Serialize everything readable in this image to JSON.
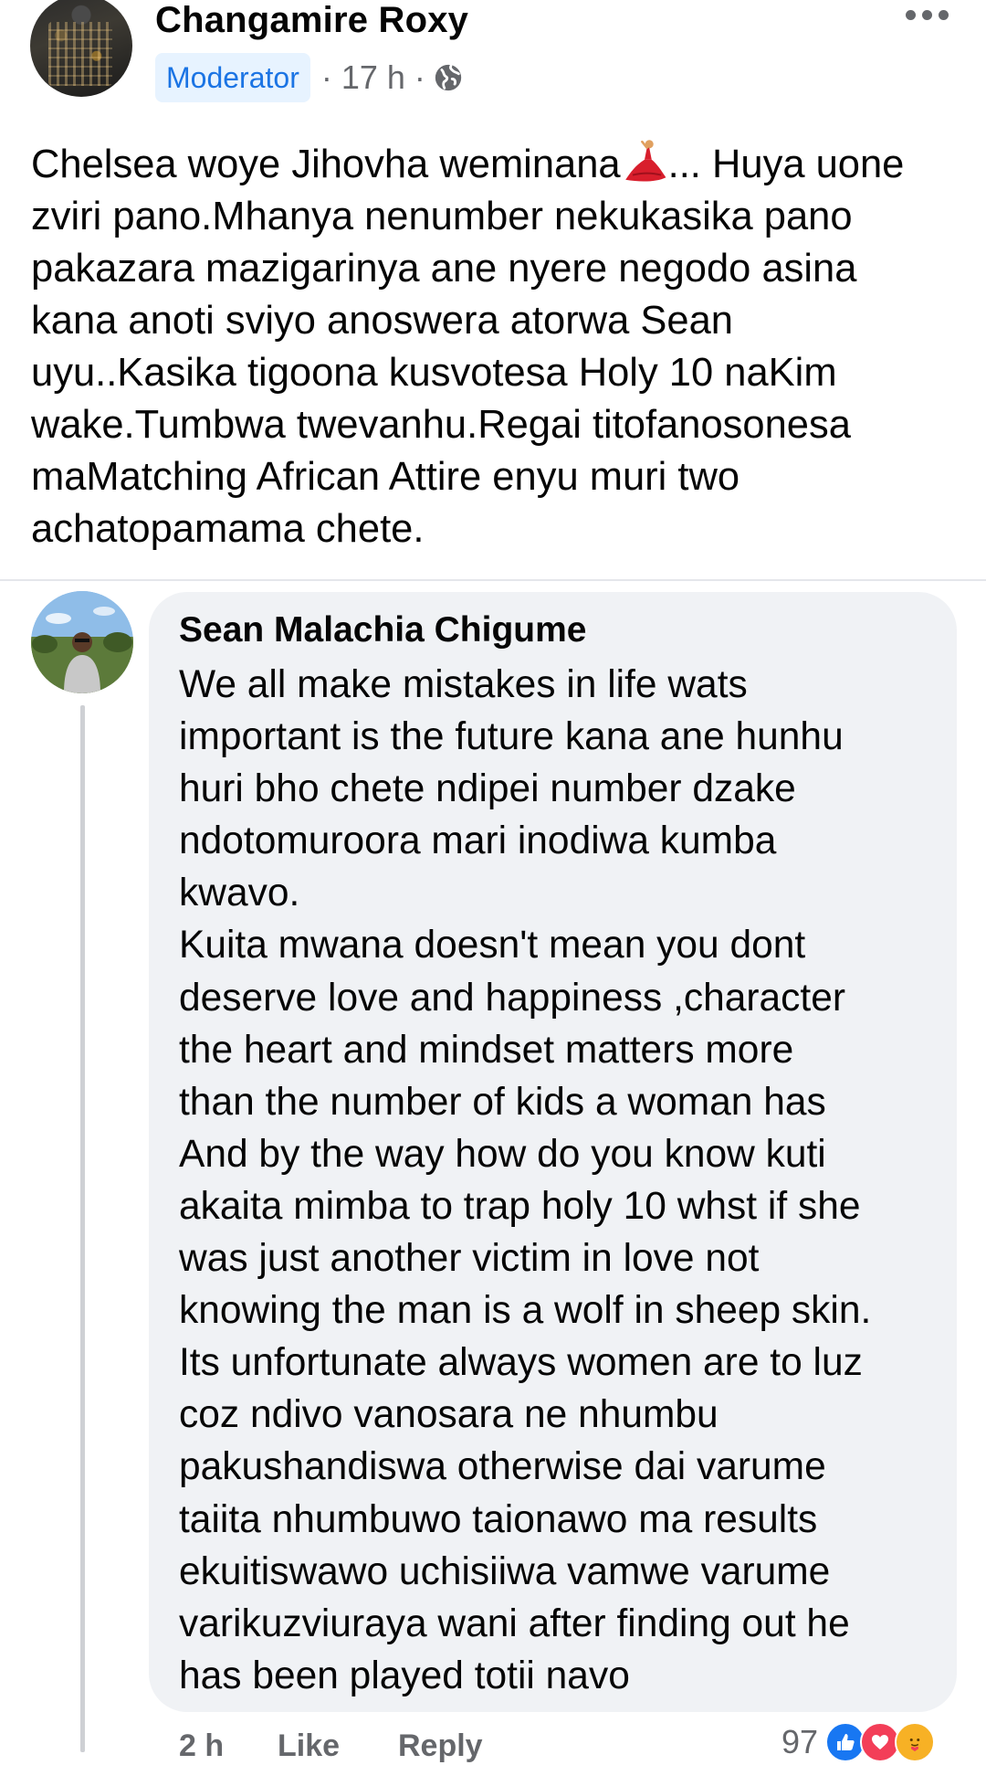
{
  "post": {
    "author": "Changamire Roxy",
    "badge": "Moderator",
    "time": "· 17 h ·",
    "privacy_icon": "globe-icon",
    "menu_icon": "more-options-icon",
    "body_before_emoji": "Chelsea woye Jihovha weminana",
    "emoji": "dancer-emoji",
    "body_after_emoji": "... Huya uone\nzviri pano.Mhanya nenumber nekukasika pano\npakazara mazigarinya ane nyere negodo asina\nkana anoti sviyo anoswera atorwa Sean\nuyu..Kasika tigoona kusvotesa Holy 10 naKim\nwake.Tumbwa twevanhu.Regai titofanosonesa\nmaMatching African Attire enyu muri two\nachatopamama chete."
  },
  "comment": {
    "author": "Sean Malachia Chigume",
    "text": "We all make mistakes in life wats\nimportant is the future kana ane hunhu\nhuri bho chete ndipei number dzake\nndotomuroora mari inodiwa kumba\nkwavo.\nKuita mwana doesn't mean you dont\ndeserve love and happiness ,character\nthe heart and mindset matters more\nthan the number of kids a woman has\nAnd by the way how do you know kuti\nakaita mimba to trap holy 10 whst if she\nwas just another victim in love not\nknowing the man is a wolf in sheep skin.\nIts unfortunate always women are to luz\ncoz ndivo vanosara ne nhumbu\npakushandiswa  otherwise dai varume\ntaiita nhumbuwo taionawo ma results\nekuitiswawo uchisiiwa vamwe varume\nvarikuzviuraya wani after finding out he\nhas been played totii navo",
    "time": "2 h",
    "like_label": "Like",
    "reply_label": "Reply",
    "reaction_count": "97",
    "reactions": [
      "like-icon",
      "love-icon",
      "care-icon"
    ]
  },
  "colors": {
    "accent": "#1b74e4",
    "badge_bg": "#e7f3ff",
    "bubble_bg": "#f0f2f5",
    "secondary_text": "#65676b",
    "like": "#1877f2",
    "love": "#f33e58",
    "care": "#f7b125"
  }
}
